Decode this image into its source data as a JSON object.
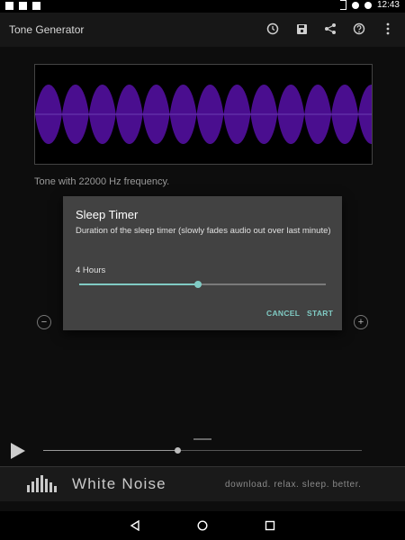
{
  "status": {
    "time": "12:43"
  },
  "app": {
    "title": "Tone Generator",
    "actions": [
      "history-icon",
      "save-icon",
      "share-icon",
      "help-icon",
      "more-vert-icon"
    ]
  },
  "tone": {
    "description": "Tone with 22000 Hz frequency."
  },
  "dialog": {
    "title": "Sleep Timer",
    "description": "Duration of the sleep timer (slowly fades audio out over last minute)",
    "value_label": "4 Hours",
    "slider_fraction": 0.48,
    "cancel_label": "CANCEL",
    "start_label": "START",
    "accent": "#80cbc4"
  },
  "player": {
    "seek_fraction": 0.42
  },
  "banner": {
    "name": "White Noise",
    "tagline": "download. relax. sleep. better."
  },
  "colors": {
    "wave": "#4a0e8f",
    "background": "#0d0d0d",
    "dialog": "#424242"
  }
}
